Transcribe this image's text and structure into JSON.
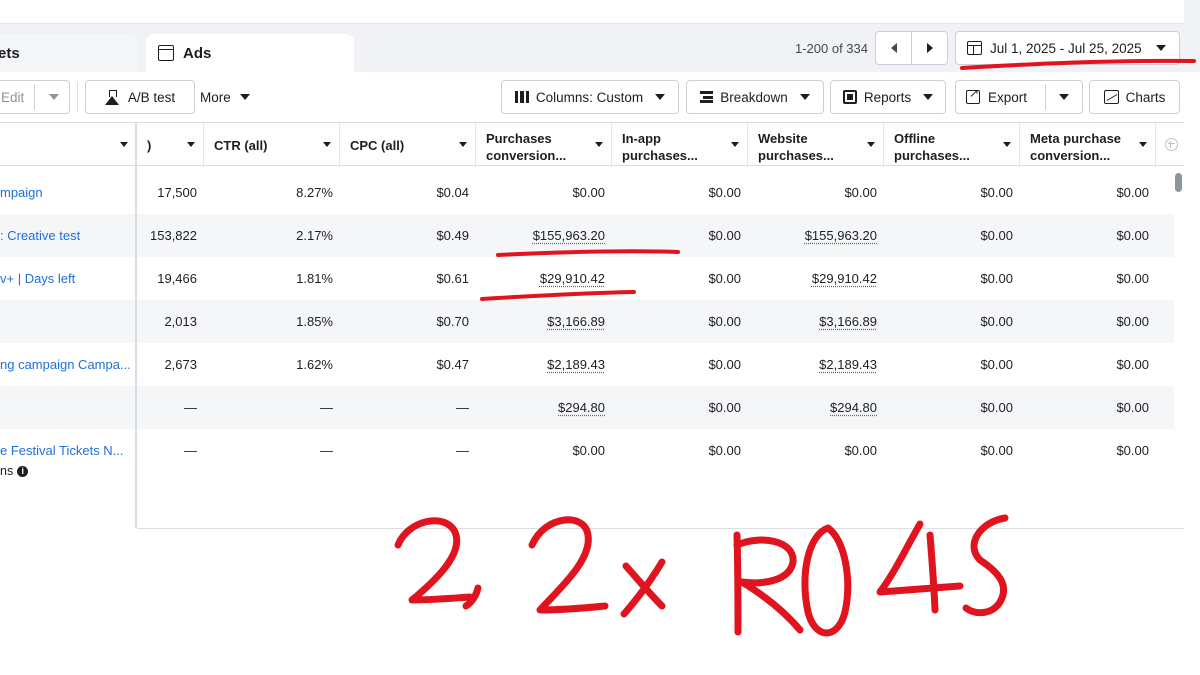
{
  "tabs": [
    {
      "label": "ets"
    },
    {
      "label": "Ads"
    }
  ],
  "pagination": {
    "range": "1-200 of 334"
  },
  "date_range": {
    "label": "Jul 1, 2025 - Jul 25, 2025"
  },
  "toolbar": {
    "edit_label": "Edit",
    "ab_test_label": "A/B test",
    "more_label": "More",
    "columns_label": "Columns: Custom",
    "breakdown_label": "Breakdown",
    "reports_label": "Reports",
    "export_label": "Export",
    "charts_label": "Charts"
  },
  "table": {
    "headers": [
      {
        "line1": "",
        "line2": ""
      },
      {
        "line1": ")",
        "line2": ""
      },
      {
        "line1": "CTR (all)",
        "line2": ""
      },
      {
        "line1": "CPC (all)",
        "line2": ""
      },
      {
        "line1": "Purchases",
        "line2": "conversion..."
      },
      {
        "line1": "In-app",
        "line2": "purchases..."
      },
      {
        "line1": "Website",
        "line2": "purchases..."
      },
      {
        "line1": "Offline",
        "line2": "purchases..."
      },
      {
        "line1": "Meta purchase",
        "line2": "conversion..."
      }
    ],
    "rows": [
      [
        "mpaign",
        "17,500",
        "8.27%",
        "$0.04",
        "$0.00",
        "$0.00",
        "$0.00",
        "$0.00",
        "$0.00"
      ],
      [
        ": Creative test",
        "153,822",
        "2.17%",
        "$0.49",
        "$155,963.20",
        "$0.00",
        "$155,963.20",
        "$0.00",
        "$0.00"
      ],
      [
        "v+ | Days left",
        "19,466",
        "1.81%",
        "$0.61",
        "$29,910.42",
        "$0.00",
        "$29,910.42",
        "$0.00",
        "$0.00"
      ],
      [
        "",
        "2,013",
        "1.85%",
        "$0.70",
        "$3,166.89",
        "$0.00",
        "$3,166.89",
        "$0.00",
        "$0.00"
      ],
      [
        "ng campaign Campa...",
        "2,673",
        "1.62%",
        "$0.47",
        "$2,189.43",
        "$0.00",
        "$2,189.43",
        "$0.00",
        "$0.00"
      ],
      [
        "",
        "—",
        "—",
        "—",
        "$294.80",
        "$0.00",
        "$294.80",
        "$0.00",
        "$0.00"
      ],
      [
        "e Festival Tickets N...",
        "—",
        "—",
        "—",
        "$0.00",
        "$0.00",
        "$0.00",
        "$0.00",
        "$0.00"
      ]
    ],
    "footer_text": "ns"
  },
  "annotation": {
    "text": "2,2x ROAS",
    "color": "#e0141e"
  },
  "colors": {
    "link": "#216fdb",
    "annotation_red": "#e0141e"
  }
}
